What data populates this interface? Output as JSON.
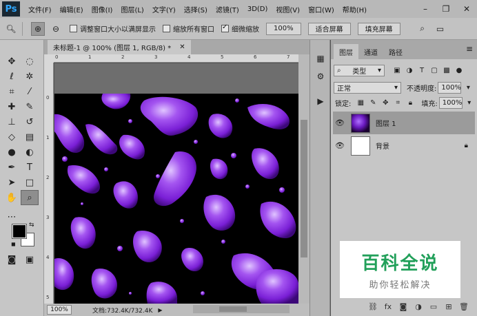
{
  "app": {
    "logo": "Ps"
  },
  "menu": [
    "文件(F)",
    "编辑(E)",
    "图像(I)",
    "图层(L)",
    "文字(Y)",
    "选择(S)",
    "滤镜(T)",
    "3D(D)",
    "视图(V)",
    "窗口(W)",
    "帮助(H)"
  ],
  "options": {
    "chk_resize": "调整窗口大小以满屏显示",
    "chk_all_windows": "缩放所有窗口",
    "chk_scrubby": "细微缩放",
    "btn_100": "100%",
    "btn_fit": "适合屏幕",
    "btn_fill": "填充屏幕"
  },
  "document": {
    "tab_title": "未标题-1 @ 100% (图层 1, RGB/8) *",
    "zoom": "100%",
    "doc_info": "文档:732.4K/732.4K"
  },
  "rulers": {
    "top": [
      "0",
      "1",
      "2",
      "3",
      "4",
      "5",
      "6",
      "7"
    ],
    "left": [
      "0",
      "1",
      "2",
      "3",
      "4",
      "5"
    ]
  },
  "layers_panel": {
    "tabs": [
      "图层",
      "通道",
      "路径"
    ],
    "filter_kind": "类型",
    "blend_mode": "正常",
    "opacity_label": "不透明度:",
    "opacity": "100%",
    "lock_label": "锁定:",
    "fill_label": "填充:",
    "fill": "100%",
    "layers": [
      {
        "name": "图层 1",
        "active": true
      },
      {
        "name": "背景",
        "active": false,
        "locked": true
      }
    ]
  },
  "watermark": {
    "title": "百科全说",
    "subtitle": "助你轻松解决"
  },
  "colors": {
    "plasma_light": "#c08cff",
    "plasma_mid": "#8a2be2",
    "plasma_dark": "#4b0a8a",
    "watermark_green": "#22a05a"
  }
}
